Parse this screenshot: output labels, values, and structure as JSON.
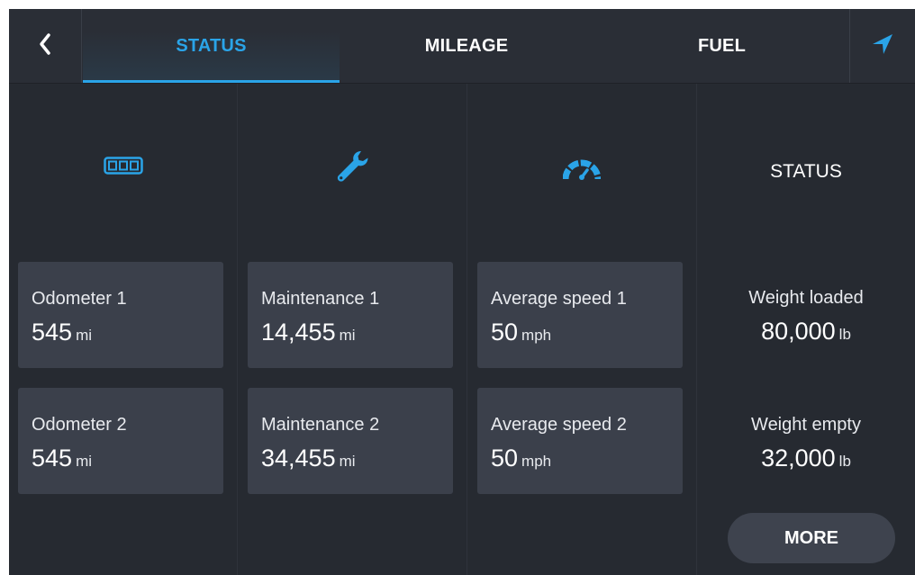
{
  "tabs": [
    {
      "label": "STATUS",
      "active": true
    },
    {
      "label": "MILEAGE",
      "active": false
    },
    {
      "label": "FUEL",
      "active": false
    }
  ],
  "icons": {
    "back": "chevron-left-icon",
    "navigation": "navigation-arrow-icon",
    "odometer": "odometer-icon",
    "maintenance": "wrench-icon",
    "speed": "speedometer-icon"
  },
  "colors": {
    "accent": "#2aa4e8",
    "background": "#262a31",
    "card": "#3b404b"
  },
  "columns": {
    "odometer": [
      {
        "label": "Odometer 1",
        "value": "545",
        "unit": "mi"
      },
      {
        "label": "Odometer 2",
        "value": "545",
        "unit": "mi"
      }
    ],
    "maintenance": [
      {
        "label": "Maintenance 1",
        "value": "14,455",
        "unit": "mi"
      },
      {
        "label": "Maintenance 2",
        "value": "34,455",
        "unit": "mi"
      }
    ],
    "speed": [
      {
        "label": "Average speed 1",
        "value": "50",
        "unit": "mph"
      },
      {
        "label": "Average speed 2",
        "value": "50",
        "unit": "mph"
      }
    ]
  },
  "status": {
    "heading": "STATUS",
    "items": [
      {
        "label": "Weight loaded",
        "value": "80,000",
        "unit": "lb"
      },
      {
        "label": "Weight empty",
        "value": "32,000",
        "unit": "lb"
      }
    ],
    "more_label": "MORE"
  }
}
